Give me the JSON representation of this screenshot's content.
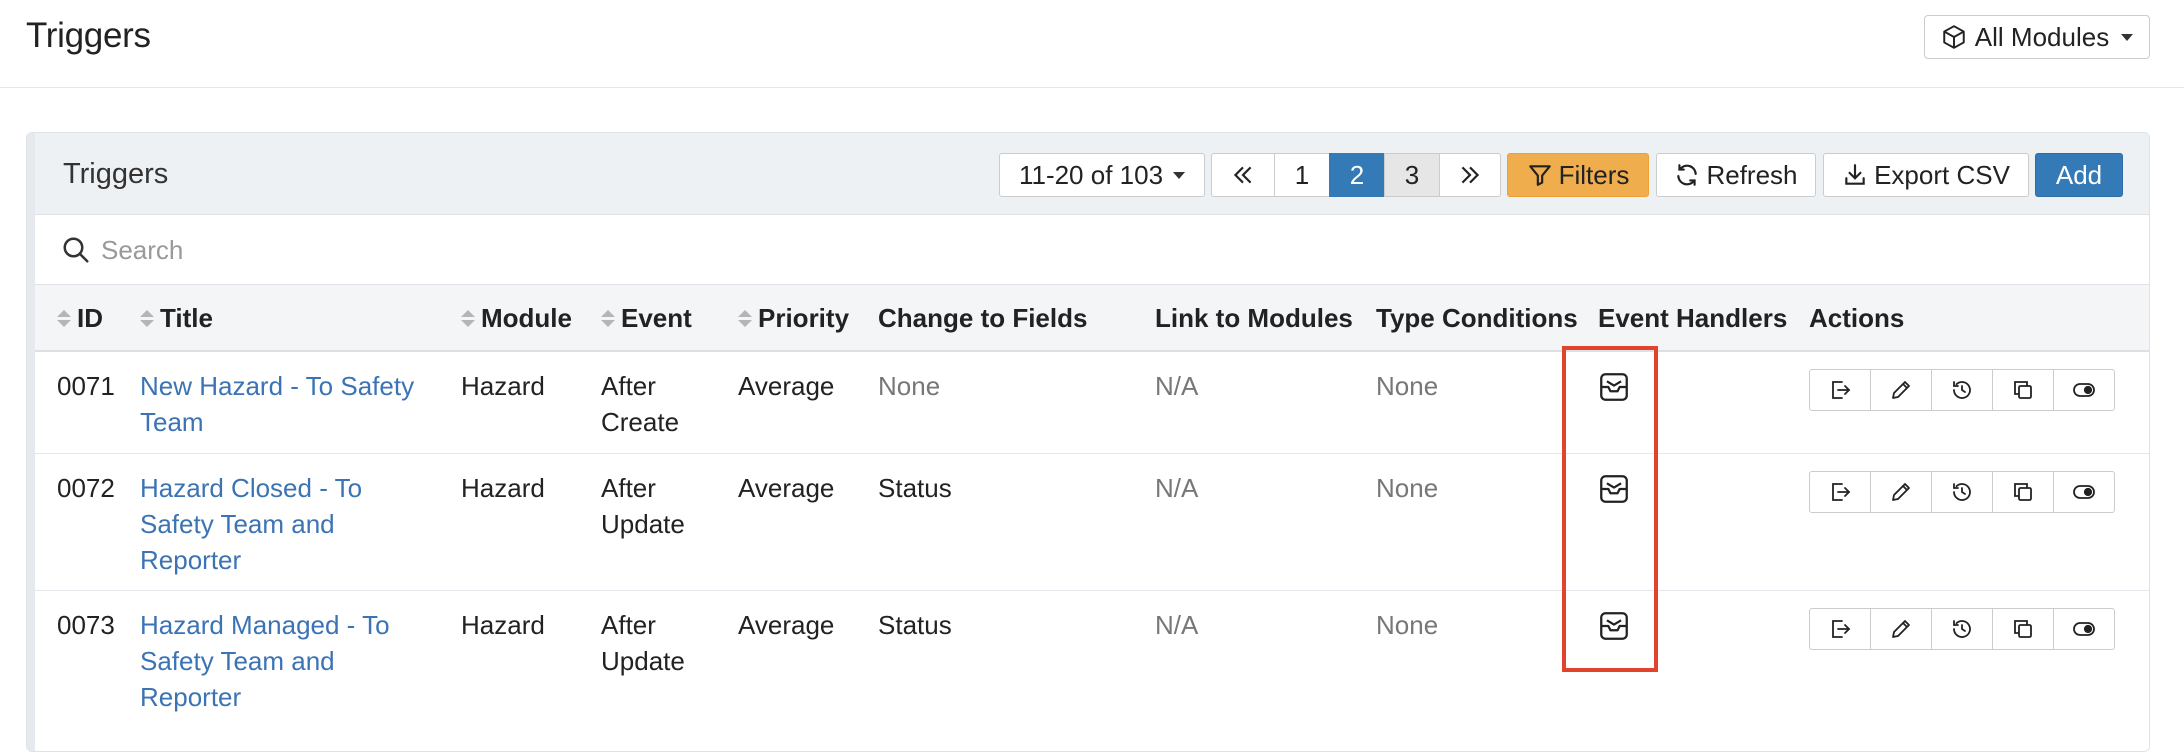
{
  "header": {
    "title": "Triggers",
    "modules_label": "All Modules",
    "modules_icon": "cube-icon"
  },
  "panel": {
    "title": "Triggers",
    "range_label": "11-20 of 103",
    "pages": [
      "1",
      "2",
      "3"
    ],
    "active_page": "2",
    "filters_label": "Filters",
    "refresh_label": "Refresh",
    "export_label": "Export CSV",
    "add_label": "Add"
  },
  "search": {
    "placeholder": "Search"
  },
  "columns": {
    "id": "ID",
    "title": "Title",
    "module": "Module",
    "event": "Event",
    "priority": "Priority",
    "change_fields": "Change to Fields",
    "link_modules": "Link to Modules",
    "type_conditions": "Type Conditions",
    "event_handlers": "Event Handlers",
    "actions": "Actions"
  },
  "rows": [
    {
      "id": "0071",
      "title_1": "New Hazard - To Safety",
      "title_2": "Team",
      "title_3": "",
      "module": "Hazard",
      "event_1": "After",
      "event_2": "Create",
      "priority": "Average",
      "change_fields": "None",
      "link_modules": "N/A",
      "type_conditions": "None"
    },
    {
      "id": "0072",
      "title_1": "Hazard Closed - To",
      "title_2": "Safety Team and",
      "title_3": "Reporter",
      "module": "Hazard",
      "event_1": "After",
      "event_2": "Update",
      "priority": "Average",
      "change_fields": "Status",
      "link_modules": "N/A",
      "type_conditions": "None"
    },
    {
      "id": "0073",
      "title_1": "Hazard Managed - To",
      "title_2": "Safety Team and",
      "title_3": "Reporter",
      "module": "Hazard",
      "event_1": "After",
      "event_2": "Update",
      "priority": "Average",
      "change_fields": "Status",
      "link_modules": "N/A",
      "type_conditions": "None"
    }
  ],
  "colors": {
    "accent": "#337ab7",
    "filters": "#f0ad4e",
    "link": "#3b73b4",
    "highlight": "#e0442d"
  }
}
